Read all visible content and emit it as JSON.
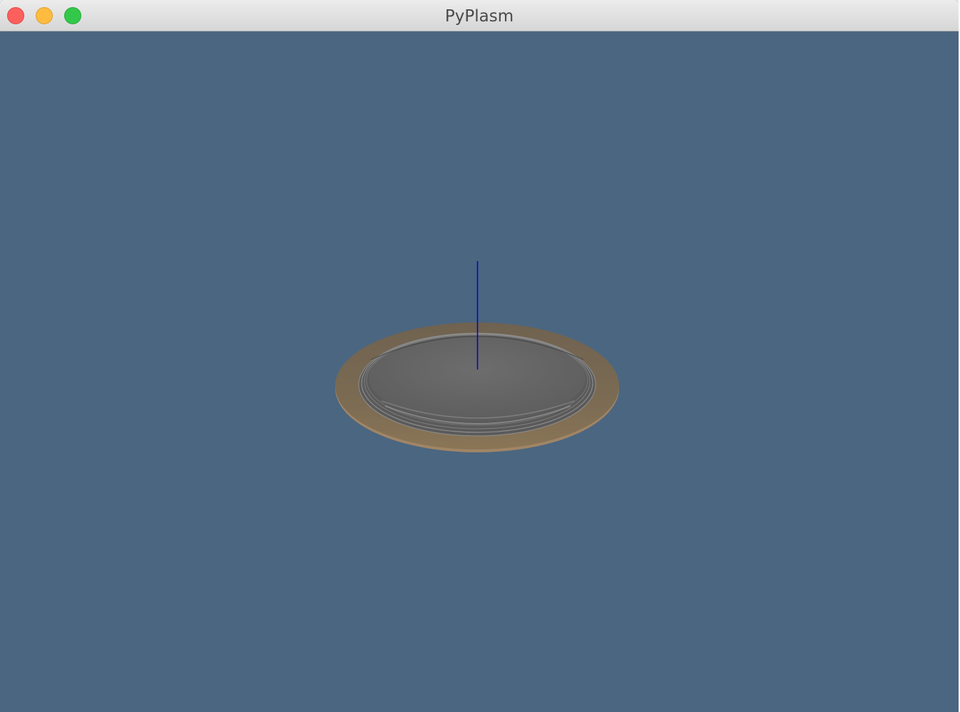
{
  "window": {
    "title": "PyPlasm"
  },
  "controls": {
    "close_icon": "close-icon",
    "minimize_icon": "minimize-icon",
    "maximize_icon": "maximize-icon"
  },
  "viewport": {
    "background_color": "#4b6680",
    "model": {
      "rim_color": "#7a6a52",
      "dish_color": "#676767",
      "axis_color": "#0000cc"
    }
  }
}
